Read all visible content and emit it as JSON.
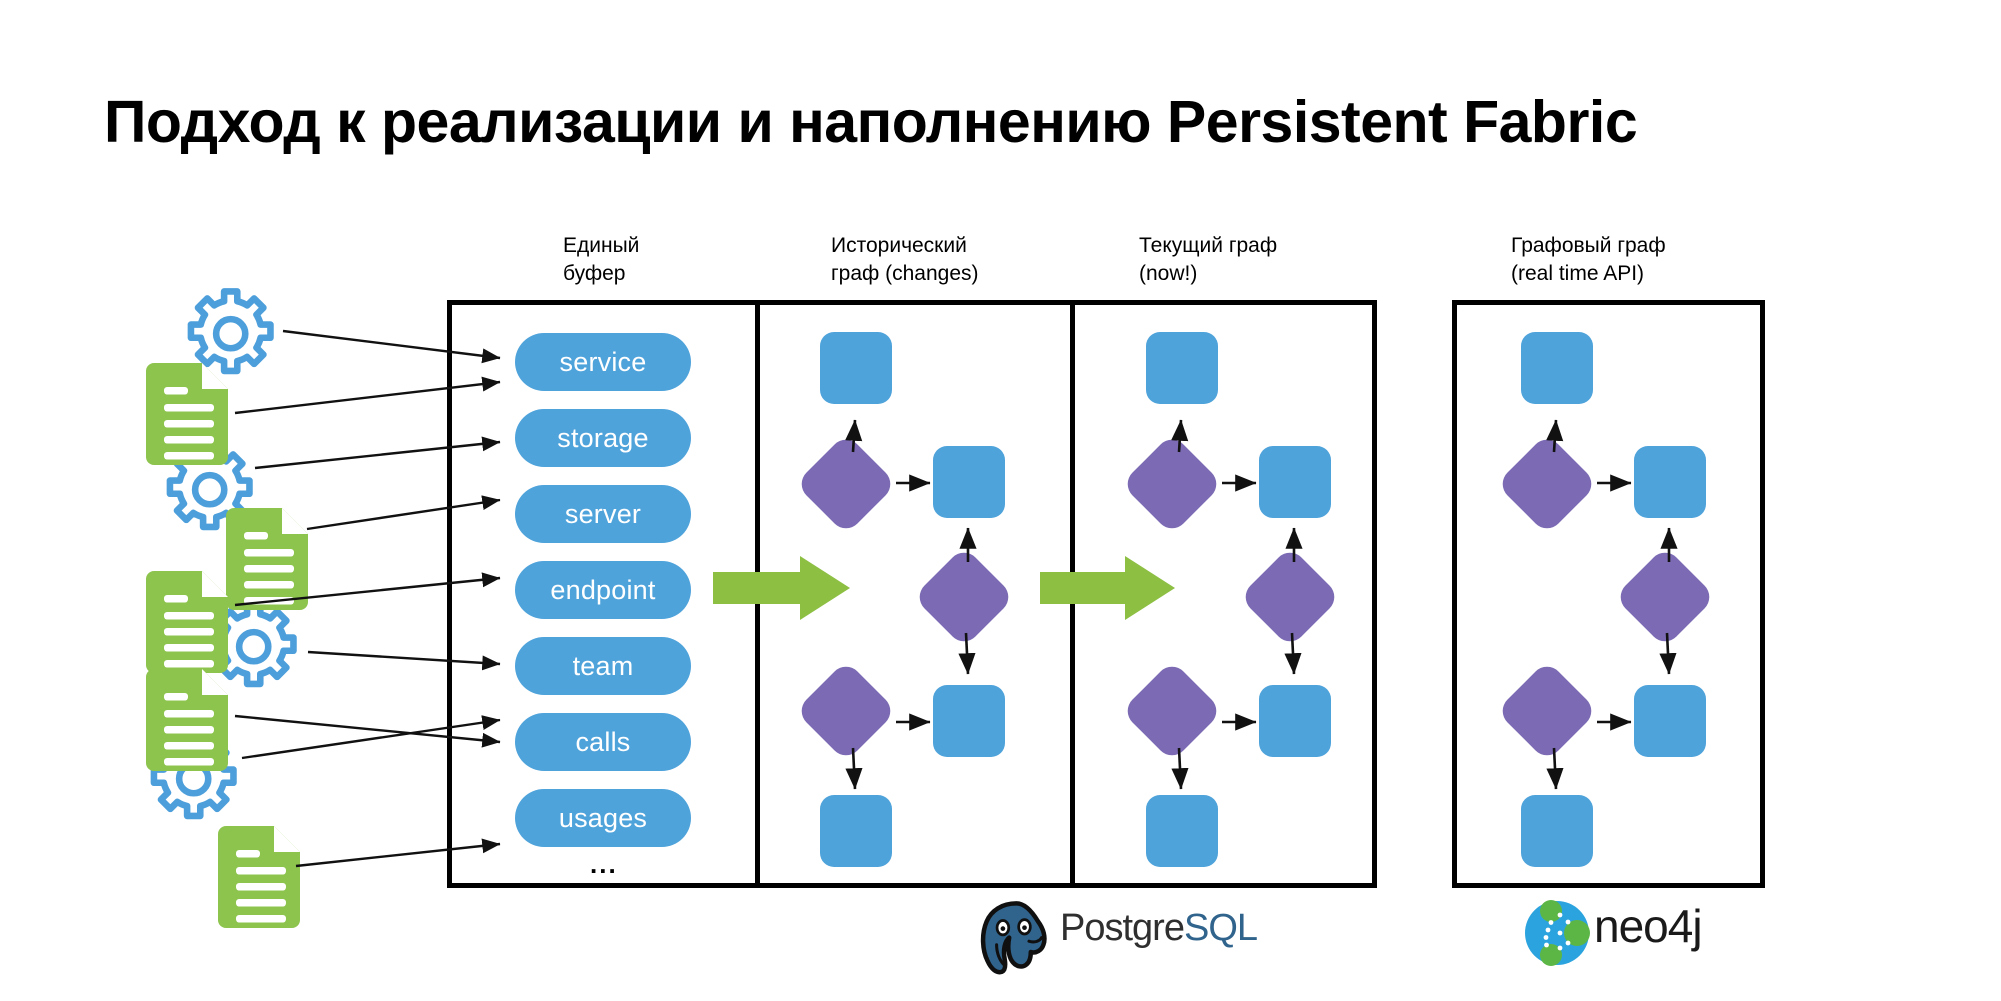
{
  "slide": {
    "title": "Подход к реализации и наполнению Persistent Fabric",
    "background_color": "#FFFFFF"
  },
  "colors": {
    "node_blue": "#4FA3DB",
    "node_purple": "#7C6BB4",
    "flow_arrow_green": "#8DBF43",
    "doc_icon_green": "#8DC44E",
    "gear_icon_blue": "#4D9FDB",
    "panel_border": "#000000"
  },
  "columns": [
    {
      "id": "buffer",
      "caption": "Единый\nбуфер"
    },
    {
      "id": "historical",
      "caption": "Исторический\nграф (changes)"
    },
    {
      "id": "current",
      "caption": "Текущий граф\n(now!)"
    },
    {
      "id": "graphdb",
      "caption": "Графовый граф\n(real time API)"
    }
  ],
  "buffer": {
    "pills": [
      {
        "label": "service"
      },
      {
        "label": "storage"
      },
      {
        "label": "server"
      },
      {
        "label": "endpoint"
      },
      {
        "label": "team"
      },
      {
        "label": "calls"
      },
      {
        "label": "usages"
      }
    ],
    "more_indicator": "..."
  },
  "sources": {
    "icons": [
      {
        "type": "gear-icon",
        "label": "gear"
      },
      {
        "type": "document-icon",
        "label": "document"
      },
      {
        "type": "gear-icon",
        "label": "gear"
      },
      {
        "type": "document-icon",
        "label": "document"
      },
      {
        "type": "document-icon",
        "label": "document"
      },
      {
        "type": "gear-icon",
        "label": "gear"
      },
      {
        "type": "document-icon",
        "label": "document"
      },
      {
        "type": "gear-icon",
        "label": "gear"
      },
      {
        "type": "document-icon",
        "label": "document"
      }
    ]
  },
  "graph": {
    "nodes": [
      {
        "id": "n1",
        "shape": "square",
        "color": "#4FA3DB"
      },
      {
        "id": "n2",
        "shape": "diamond",
        "color": "#7C6BB4"
      },
      {
        "id": "n3",
        "shape": "square",
        "color": "#4FA3DB"
      },
      {
        "id": "n4",
        "shape": "diamond",
        "color": "#7C6BB4"
      },
      {
        "id": "n5",
        "shape": "diamond",
        "color": "#7C6BB4"
      },
      {
        "id": "n6",
        "shape": "square",
        "color": "#4FA3DB"
      },
      {
        "id": "n7",
        "shape": "square",
        "color": "#4FA3DB"
      }
    ],
    "edges": [
      {
        "from": "n2",
        "to": "n1"
      },
      {
        "from": "n2",
        "to": "n3"
      },
      {
        "from": "n4",
        "to": "n3"
      },
      {
        "from": "n4",
        "to": "n6"
      },
      {
        "from": "n5",
        "to": "n6"
      },
      {
        "from": "n5",
        "to": "n7"
      }
    ]
  },
  "flow_arrows": [
    {
      "id": "arrow-buffer-to-historical"
    },
    {
      "id": "arrow-historical-to-current"
    }
  ],
  "logos": {
    "postgres": {
      "name": "PostgreSQL",
      "part1": "Postgre",
      "part2": "SQL"
    },
    "neo4j": {
      "name": "neo4j",
      "text": "neo4j"
    }
  }
}
